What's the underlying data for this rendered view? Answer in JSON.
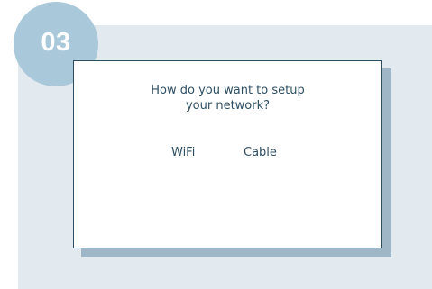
{
  "step": {
    "number": "03"
  },
  "dialog": {
    "question_line1": "How do you want to setup",
    "question_line2": "your network?",
    "options": [
      {
        "label": "WiFi"
      },
      {
        "label": "Cable"
      }
    ]
  },
  "colors": {
    "panel_background": "#e2e9ef",
    "badge": "#a9c8d9",
    "dialog_border": "#2d4e62",
    "dialog_shadow": "#9fb6c6",
    "text": "#2d4e62"
  }
}
